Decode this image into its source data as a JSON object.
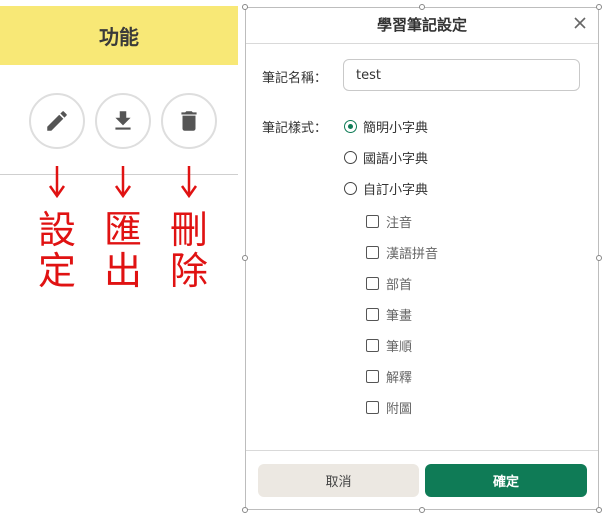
{
  "left_panel": {
    "header": "功能",
    "buttons": [
      {
        "icon": "pencil-icon",
        "name": "edit"
      },
      {
        "icon": "download-icon",
        "name": "export"
      },
      {
        "icon": "trash-icon",
        "name": "delete"
      }
    ],
    "labels": [
      {
        "line1": "設",
        "line2": "定"
      },
      {
        "line1": "匯",
        "line2": "出"
      },
      {
        "line1": "刪",
        "line2": "除"
      }
    ],
    "label_color": "#e01212"
  },
  "dialog": {
    "title": "學習筆記設定",
    "close_icon": "close-icon",
    "name_label": "筆記名稱：",
    "name_value": "test",
    "style_label": "筆記樣式：",
    "style_options": [
      {
        "label": "簡明小字典",
        "checked": true
      },
      {
        "label": "國語小字典",
        "checked": false
      },
      {
        "label": "自訂小字典",
        "checked": false
      }
    ],
    "custom_options": [
      {
        "label": "注音",
        "checked": false
      },
      {
        "label": "漢語拼音",
        "checked": false
      },
      {
        "label": "部首",
        "checked": false
      },
      {
        "label": "筆畫",
        "checked": false
      },
      {
        "label": "筆順",
        "checked": false
      },
      {
        "label": "解釋",
        "checked": false
      },
      {
        "label": "附圖",
        "checked": false
      }
    ],
    "cancel_label": "取消",
    "confirm_label": "確定",
    "accent_color": "#0f7b56"
  }
}
